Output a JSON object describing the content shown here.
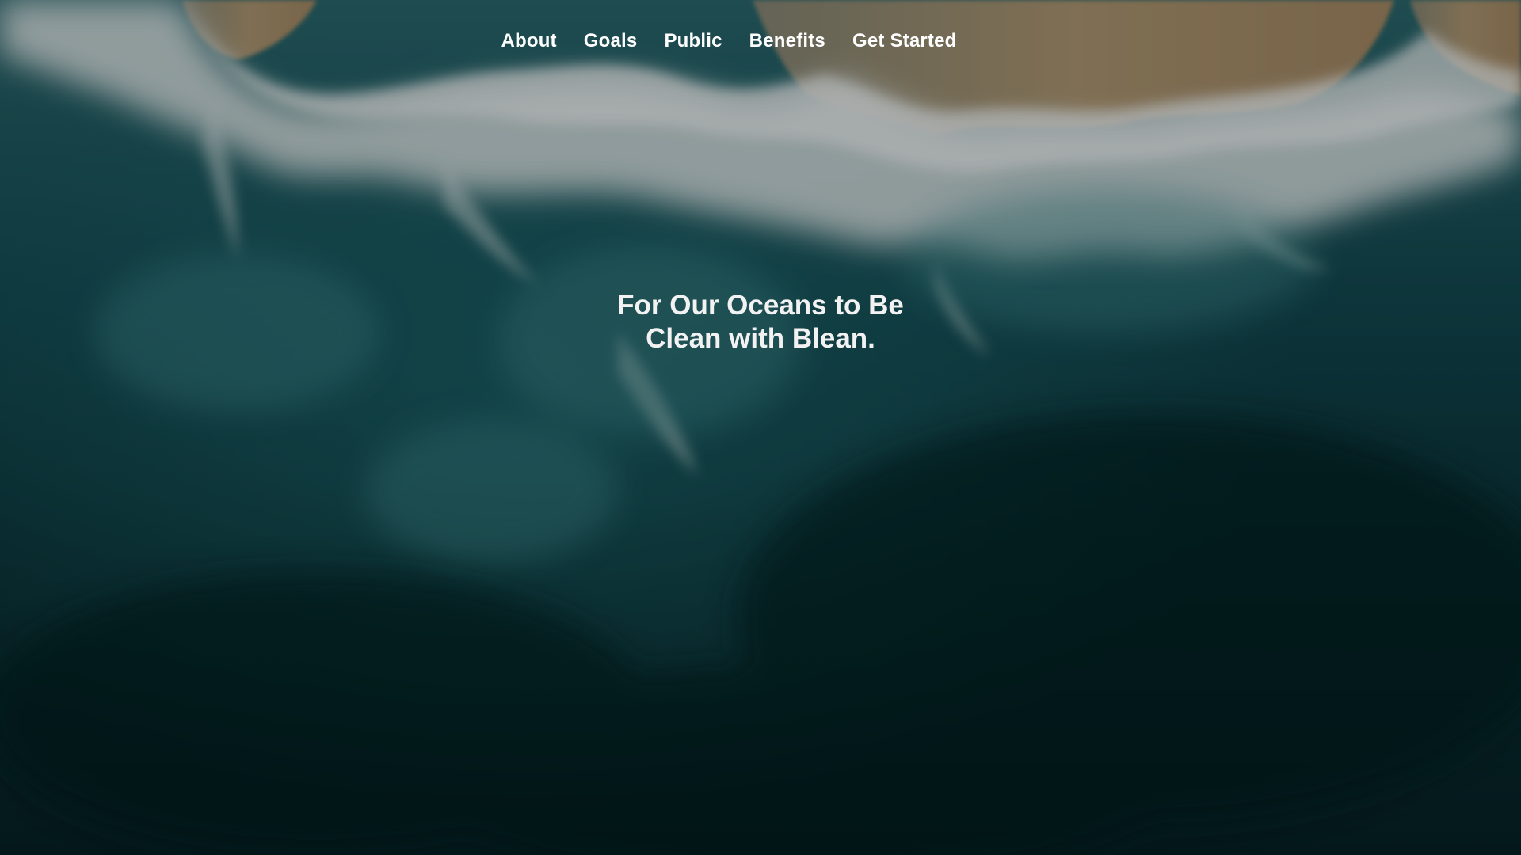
{
  "nav": {
    "items": [
      {
        "label": "About"
      },
      {
        "label": "Goals"
      },
      {
        "label": "Public"
      },
      {
        "label": "Benefits"
      },
      {
        "label": "Get Started"
      }
    ]
  },
  "hero": {
    "headline_line1": "For Our Oceans to Be",
    "headline_line2": "Clean with Blean.",
    "background": "aerial-ocean-waves-photo"
  },
  "colors": {
    "deep_water": "#062226",
    "teal_water": "#1d5a60",
    "foam": "#dfe8e8",
    "sand": "#a89070",
    "text": "#ffffff"
  }
}
